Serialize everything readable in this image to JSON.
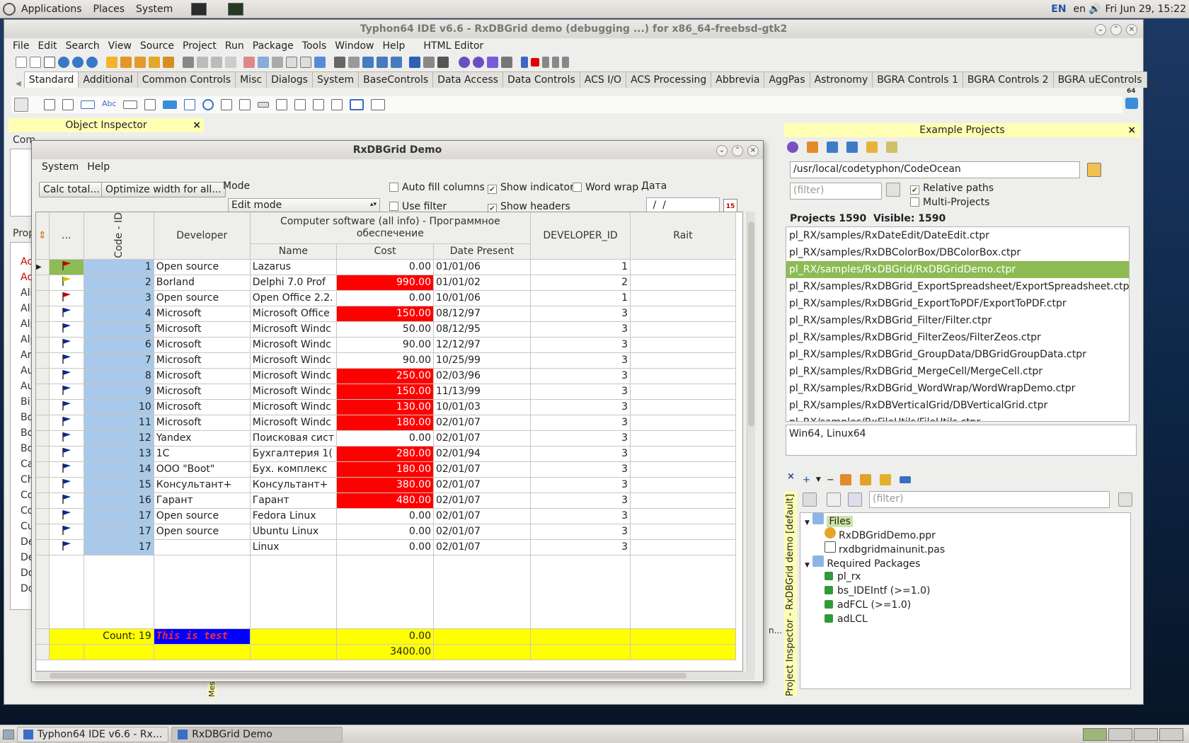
{
  "top_panel": {
    "menus": [
      "Applications",
      "Places",
      "System"
    ],
    "lang_code": "EN",
    "lang": "en",
    "clock": "Fri Jun 29, 15:22"
  },
  "taskbar": {
    "items": [
      "Typhon64 IDE v6.6 - Rx...",
      "RxDBGrid Demo"
    ]
  },
  "ide": {
    "title": "Typhon64 IDE v6.6 - RxDBGrid demo (debugging ...) for x86_64-freebsd-gtk2",
    "menu": [
      "File",
      "Edit",
      "Search",
      "View",
      "Source",
      "Project",
      "Run",
      "Package",
      "Tools",
      "Window",
      "Help",
      "HTML Editor"
    ],
    "palette_tabs": [
      "Standard",
      "Additional",
      "Common Controls",
      "Misc",
      "Dialogs",
      "System",
      "BaseControls",
      "Data Access",
      "Data Controls",
      "ACS I/O",
      "ACS Processing",
      "Abbrevia",
      "AggPas",
      "Astronomy",
      "BGRA Controls 1",
      "BGRA Controls 2",
      "BGRA uEControls"
    ],
    "palette_badge": "64",
    "object_inspector": "Object Inspector",
    "left_fragments": [
      "Com",
      "Prop",
      "Ac",
      "Ac",
      "Ali",
      "All",
      "Alp",
      "Alp",
      "An",
      "Au",
      "Au",
      "Bi",
      "Bo",
      "Bo",
      "Bo",
      "Ca",
      "Ch",
      "Co",
      "Co",
      "Cu",
      "De",
      "De",
      "Do",
      "Do"
    ],
    "bottom_fragment": "Mes",
    "n_fragment": "n..."
  },
  "dialog": {
    "title": "RxDBGrid Demo",
    "menu": [
      "System",
      "Help"
    ],
    "btn_calc": "Calc total...",
    "btn_optimize": "Optimize width for all...",
    "mode_label": "Mode",
    "mode_value": "Edit mode",
    "cb_autofill": "Auto fill columns",
    "cb_indicator": "Show indicator",
    "cb_wordwrap": "Word wrap",
    "cb_usefilter": "Use filter",
    "cb_headers": "Show headers",
    "date_label": "Дата",
    "date_value": " /  /",
    "calendar_badge": "15"
  },
  "grid": {
    "header_dots": "...",
    "header_code": "Code - ID",
    "header_developer": "Developer",
    "header_group": "Computer software (all info) - Программное обеспечение",
    "header_name": "Name",
    "header_cost": "Cost",
    "header_date": "Date Present",
    "header_devid": "DEVELOPER_ID",
    "header_rait": "Rait",
    "rows": [
      {
        "id": "1",
        "dev": "Open source",
        "name": "Lazarus",
        "cost": "0.00",
        "date": "01/01/06",
        "devid": "1",
        "hi": false,
        "flag": "#c00000",
        "flagbg": "#8dbb54"
      },
      {
        "id": "2",
        "dev": "Borland",
        "name": "Delphi 7.0 Prof",
        "cost": "990.00",
        "date": "01/01/02",
        "devid": "2",
        "hi": true,
        "flag": "#d4c400",
        "flagbg": ""
      },
      {
        "id": "3",
        "dev": "Open source",
        "name": "Open Office 2.2.",
        "cost": "0.00",
        "date": "10/01/06",
        "devid": "1",
        "hi": false,
        "flag": "#c00000",
        "flagbg": ""
      },
      {
        "id": "4",
        "dev": "Microsoft",
        "name": "Microsoft Office",
        "cost": "150.00",
        "date": "08/12/97",
        "devid": "3",
        "hi": true,
        "flag": "#0a2a8a",
        "flagbg": ""
      },
      {
        "id": "5",
        "dev": "Microsoft",
        "name": "Microsoft Windc",
        "cost": "50.00",
        "date": "08/12/95",
        "devid": "3",
        "hi": false,
        "flag": "#0a2a8a",
        "flagbg": ""
      },
      {
        "id": "6",
        "dev": "Microsoft",
        "name": "Microsoft Windc",
        "cost": "90.00",
        "date": "12/12/97",
        "devid": "3",
        "hi": false,
        "flag": "#0a2a8a",
        "flagbg": ""
      },
      {
        "id": "7",
        "dev": "Microsoft",
        "name": "Microsoft Windc",
        "cost": "90.00",
        "date": "10/25/99",
        "devid": "3",
        "hi": false,
        "flag": "#0a2a8a",
        "flagbg": ""
      },
      {
        "id": "8",
        "dev": "Microsoft",
        "name": "Microsoft Windc",
        "cost": "250.00",
        "date": "02/03/96",
        "devid": "3",
        "hi": true,
        "flag": "#0a2a8a",
        "flagbg": ""
      },
      {
        "id": "9",
        "dev": "Microsoft",
        "name": "Microsoft Windc",
        "cost": "150.00",
        "date": "11/13/99",
        "devid": "3",
        "hi": true,
        "flag": "#0a2a8a",
        "flagbg": ""
      },
      {
        "id": "10",
        "dev": "Microsoft",
        "name": "Microsoft Windc",
        "cost": "130.00",
        "date": "10/01/03",
        "devid": "3",
        "hi": true,
        "flag": "#0a2a8a",
        "flagbg": ""
      },
      {
        "id": "11",
        "dev": "Microsoft",
        "name": "Microsoft Windc",
        "cost": "180.00",
        "date": "02/01/07",
        "devid": "3",
        "hi": true,
        "flag": "#0a2a8a",
        "flagbg": ""
      },
      {
        "id": "12",
        "dev": "Yandex",
        "name": "Поисковая сист",
        "cost": "0.00",
        "date": "02/01/07",
        "devid": "3",
        "hi": false,
        "flag": "#0a2a8a",
        "flagbg": ""
      },
      {
        "id": "13",
        "dev": "1C",
        "name": "Бухгалтерия 1(",
        "cost": "280.00",
        "date": "02/01/94",
        "devid": "3",
        "hi": true,
        "flag": "#0a2a8a",
        "flagbg": ""
      },
      {
        "id": "14",
        "dev": "ООО \"Boot\"",
        "name": "Бух. комплекс",
        "cost": "180.00",
        "date": "02/01/07",
        "devid": "3",
        "hi": true,
        "flag": "#0a2a8a",
        "flagbg": ""
      },
      {
        "id": "15",
        "dev": "Консультант+",
        "name": "Консультант+",
        "cost": "380.00",
        "date": "02/01/07",
        "devid": "3",
        "hi": true,
        "flag": "#0a2a8a",
        "flagbg": ""
      },
      {
        "id": "16",
        "dev": "Гарант",
        "name": "Гарант",
        "cost": "480.00",
        "date": "02/01/07",
        "devid": "3",
        "hi": true,
        "flag": "#0a2a8a",
        "flagbg": ""
      },
      {
        "id": "17",
        "dev": "Open source",
        "name": "Fedora Linux",
        "cost": "0.00",
        "date": "02/01/07",
        "devid": "3",
        "hi": false,
        "flag": "#0a2a8a",
        "flagbg": ""
      },
      {
        "id": "17",
        "dev": "Open source",
        "name": "Ubuntu Linux",
        "cost": "0.00",
        "date": "02/01/07",
        "devid": "3",
        "hi": false,
        "flag": "#0a2a8a",
        "flagbg": ""
      },
      {
        "id": "17",
        "dev": "",
        "name": "Linux",
        "cost": "0.00",
        "date": "02/01/07",
        "devid": "3",
        "hi": false,
        "flag": "#0a2a8a",
        "flagbg": ""
      }
    ],
    "footer_count": "Count: 19",
    "footer_test": "This is test",
    "footer_cost1": "0.00",
    "footer_cost2": "3400.00"
  },
  "examples": {
    "title": "Example Projects",
    "path": "/usr/local/codetyphon/CodeOcean",
    "filter_placeholder": "(filter)",
    "cb_relative": "Relative paths",
    "cb_multi": "Multi-Projects",
    "stats": "Projects 1590  Visible: 1590",
    "list": [
      "pl_RX/samples/RxDateEdit/DateEdit.ctpr",
      "pl_RX/samples/RxDBColorBox/DBColorBox.ctpr",
      "pl_RX/samples/RxDBGrid/RxDBGridDemo.ctpr",
      "pl_RX/samples/RxDBGrid_ExportSpreadsheet/ExportSpreadsheet.ctpr",
      "pl_RX/samples/RxDBGrid_ExportToPDF/ExportToPDF.ctpr",
      "pl_RX/samples/RxDBGrid_Filter/Filter.ctpr",
      "pl_RX/samples/RxDBGrid_FilterZeos/FilterZeos.ctpr",
      "pl_RX/samples/RxDBGrid_GroupData/DBGridGroupData.ctpr",
      "pl_RX/samples/RxDBGrid_MergeCell/MergeCell.ctpr",
      "pl_RX/samples/RxDBGrid_WordWrap/WordWrapDemo.ctpr",
      "pl_RX/samples/RxDBVerticalGrid/DBVerticalGrid.ctpr",
      "pl_RX/samples/RxFileUtils/FileUtils.ctpr"
    ],
    "selected_index": 2,
    "platforms": "Win64, Linux64"
  },
  "project_inspector": {
    "vertical_title": "Project Inspector - RxDBGrid demo [default]",
    "filter_placeholder": "(filter)",
    "files_label": "Files",
    "files": [
      "RxDBGridDemo.ppr",
      "rxdbgridmainunit.pas"
    ],
    "packages_label": "Required Packages",
    "packages": [
      "pl_rx",
      "bs_IDEIntf (>=1.0)",
      "adFCL (>=1.0)",
      "adLCL"
    ]
  }
}
